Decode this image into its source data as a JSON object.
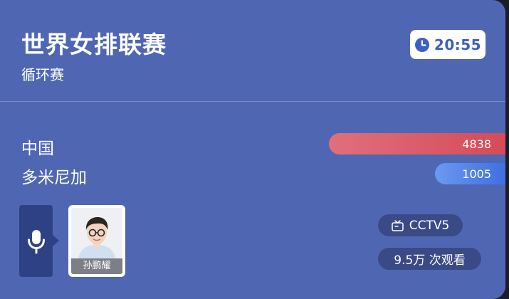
{
  "match": {
    "title": "世界女排联赛",
    "stage": "循环赛",
    "time": "20:55"
  },
  "teams": [
    {
      "name": "中国",
      "count": "4838",
      "share": 0.35,
      "color": "#d64a58"
    },
    {
      "name": "多米尼加",
      "count": "1005",
      "share": 0.14,
      "color": "#3f6fe0"
    }
  ],
  "commentator": {
    "name": "孙鹏耀"
  },
  "broadcast": {
    "channel": "CCTV5",
    "views": "9.5万 次观看"
  },
  "icons": {
    "clock": "clock-icon",
    "mic": "microphone-icon",
    "tv": "tv-icon"
  },
  "colors": {
    "card_bg": "#4f67b3",
    "accent": "#3c5fc6"
  }
}
